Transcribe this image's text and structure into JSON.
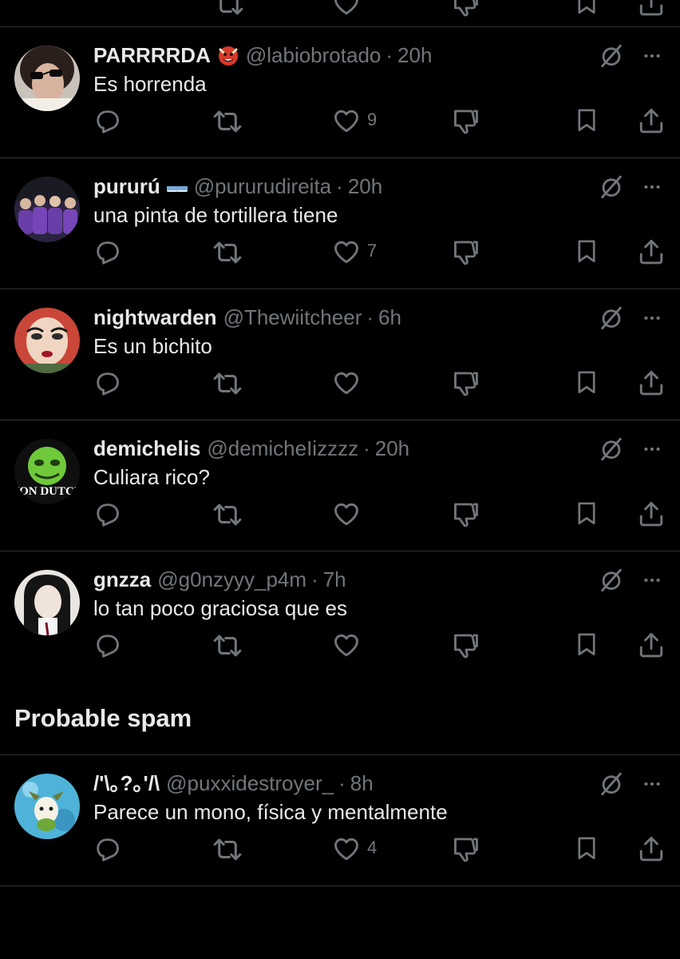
{
  "colors": {
    "background": "#000000",
    "text": "#e7e9ea",
    "muted": "#71767b",
    "divider": "#2f3336"
  },
  "icons": [
    "reply-icon",
    "retweet-icon",
    "like-icon",
    "dislike-icon",
    "bookmark-icon",
    "share-icon",
    "grok-icon",
    "more-icon"
  ],
  "replies": [
    {
      "display_name": "PARRRRDA",
      "badge": "ogre-emoji",
      "handle": "@labiobrotado",
      "separator": "·",
      "time": "20h",
      "text": "Es horrenda",
      "likes": "9"
    },
    {
      "display_name": "pururú",
      "badge": "argentina-flag",
      "handle": "@pururudireita",
      "separator": "·",
      "time": "20h",
      "text": "una pinta de tortillera tiene",
      "likes": "7"
    },
    {
      "display_name": "nightwarden",
      "handle": "@Thewiitcheer",
      "separator": "·",
      "time": "6h",
      "text": "Es un bichito",
      "likes": ""
    },
    {
      "display_name": "demichelis",
      "handle": "@demicheIizzzz",
      "separator": "·",
      "time": "20h",
      "text": "Culiara rico?",
      "likes": "",
      "avatar_logo": "VON DUTCH"
    },
    {
      "display_name": "gnzza",
      "handle": "@g0nzyyy_p4m",
      "separator": "·",
      "time": "7h",
      "text": "lo tan poco graciosa que es",
      "likes": ""
    },
    {
      "display_name": "/'\\｡?｡'/\\",
      "handle": "@puxxidestroyer_",
      "separator": "·",
      "time": "8h",
      "text": "Parece un mono, física y mentalmente",
      "likes": "4"
    }
  ],
  "sections": {
    "probable_spam": "Probable spam"
  }
}
